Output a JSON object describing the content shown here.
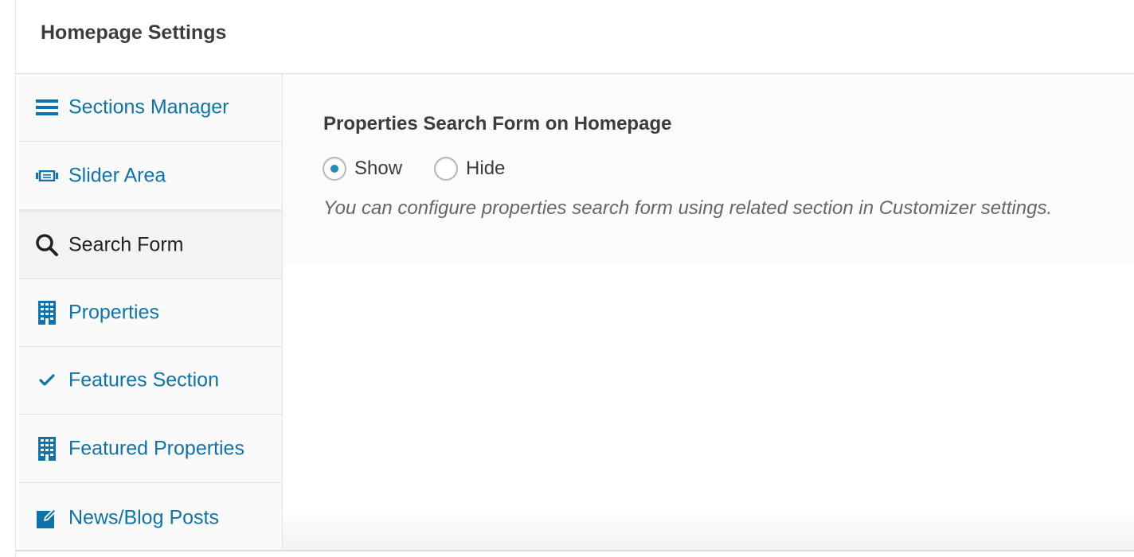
{
  "header": {
    "title": "Homepage Settings"
  },
  "sidebar": {
    "items": [
      {
        "label": "Sections Manager",
        "icon": "menu-icon",
        "active": false
      },
      {
        "label": "Slider Area",
        "icon": "slider-icon",
        "active": false
      },
      {
        "label": "Search Form",
        "icon": "search-icon",
        "active": true
      },
      {
        "label": "Properties",
        "icon": "building-icon",
        "active": false
      },
      {
        "label": "Features Section",
        "icon": "checkmark-icon",
        "active": false
      },
      {
        "label": "Featured Properties",
        "icon": "building-icon",
        "active": false
      },
      {
        "label": "News/Blog Posts",
        "icon": "edit-icon",
        "active": false
      }
    ]
  },
  "main": {
    "field_title": "Properties Search Form on Homepage",
    "options": [
      {
        "label": "Show",
        "checked": true
      },
      {
        "label": "Hide",
        "checked": false
      }
    ],
    "description": "You can configure properties search form using related section in Customizer settings."
  },
  "colors": {
    "link": "#0e73aa",
    "active_text": "#222222",
    "radio_dot": "#1e8cbe"
  }
}
